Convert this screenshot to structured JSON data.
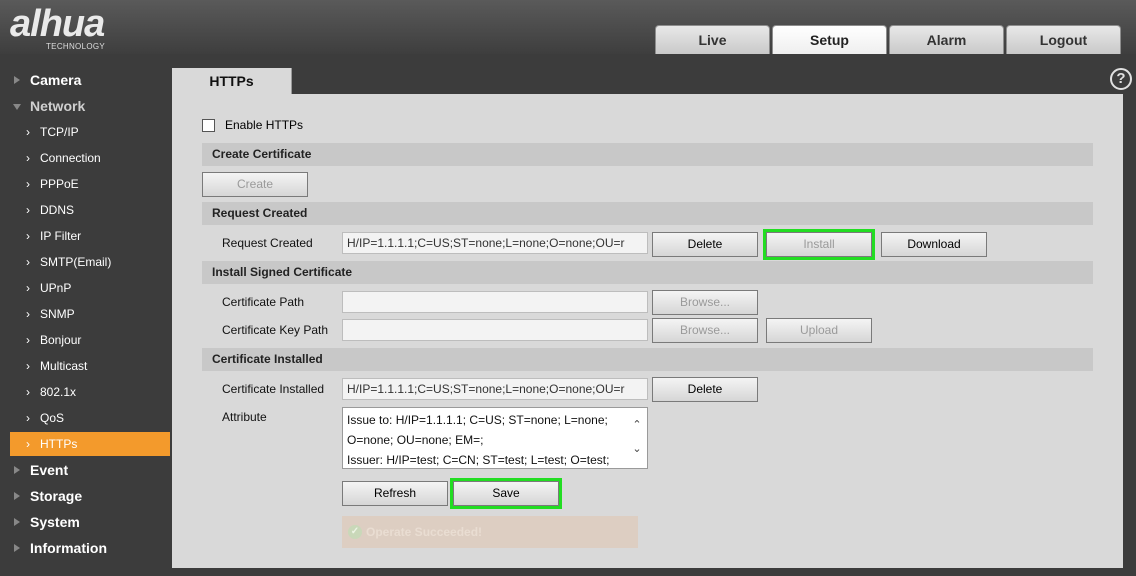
{
  "brand": {
    "logo_text": "alhua",
    "logo_sub": "TECHNOLOGY"
  },
  "topnav": {
    "tabs": [
      "Live",
      "Setup",
      "Alarm",
      "Logout"
    ],
    "active": "Setup"
  },
  "sidebar": {
    "items": [
      {
        "label": "Camera",
        "level": "top",
        "expanded": false
      },
      {
        "label": "Network",
        "level": "top",
        "expanded": true
      },
      {
        "label": "TCP/IP",
        "level": "sub"
      },
      {
        "label": "Connection",
        "level": "sub"
      },
      {
        "label": "PPPoE",
        "level": "sub"
      },
      {
        "label": "DDNS",
        "level": "sub"
      },
      {
        "label": "IP Filter",
        "level": "sub"
      },
      {
        "label": "SMTP(Email)",
        "level": "sub"
      },
      {
        "label": "UPnP",
        "level": "sub"
      },
      {
        "label": "SNMP",
        "level": "sub"
      },
      {
        "label": "Bonjour",
        "level": "sub"
      },
      {
        "label": "Multicast",
        "level": "sub"
      },
      {
        "label": "802.1x",
        "level": "sub"
      },
      {
        "label": "QoS",
        "level": "sub"
      },
      {
        "label": "HTTPs",
        "level": "sub",
        "selected": true
      },
      {
        "label": "Event",
        "level": "top",
        "expanded": false
      },
      {
        "label": "Storage",
        "level": "top",
        "expanded": false
      },
      {
        "label": "System",
        "level": "top",
        "expanded": false
      },
      {
        "label": "Information",
        "level": "top",
        "expanded": false
      }
    ]
  },
  "panel": {
    "tab_label": "HTTPs",
    "help_glyph": "?",
    "enable_label": "Enable HTTPs",
    "enable_checked": false,
    "sections": {
      "create": "Create Certificate",
      "request": "Request Created",
      "install_signed": "Install Signed Certificate",
      "installed": "Certificate Installed"
    },
    "buttons": {
      "create": "Create",
      "delete": "Delete",
      "install": "Install",
      "download": "Download",
      "browse": "Browse...",
      "upload": "Upload",
      "refresh": "Refresh",
      "save": "Save"
    },
    "labels": {
      "request_created": "Request Created",
      "cert_path": "Certificate Path",
      "cert_key_path": "Certificate Key Path",
      "cert_installed": "Certificate Installed",
      "attribute": "Attribute"
    },
    "values": {
      "request_created": "H/IP=1.1.1.1;C=US;ST=none;L=none;O=none;OU=r",
      "cert_path": "",
      "cert_key_path": "",
      "cert_installed": "H/IP=1.1.1.1;C=US;ST=none;L=none;O=none;OU=r",
      "attribute_lines": [
        "Issue to: H/IP=1.1.1.1; C=US; ST=none; L=none;",
        "O=none; OU=none; EM=;",
        "Issuer: H/IP=test; C=CN; ST=test; L=test; O=test;"
      ]
    },
    "status_message": "Operate Succeeded!",
    "highlight_color": "#22dd22"
  }
}
